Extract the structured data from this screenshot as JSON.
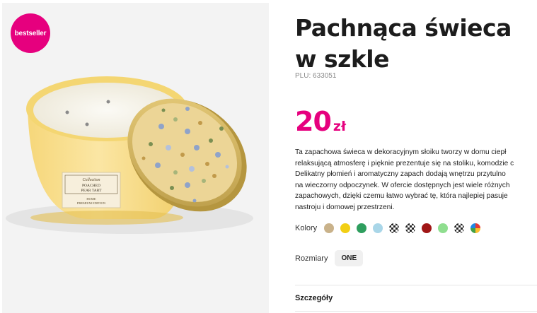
{
  "gallery": {
    "badge": "bestseller",
    "jar_label": {
      "script": "Collection",
      "name_line1": "POACHED",
      "name_line2": "PEAR TART",
      "line3": "HOME",
      "line4": "PREMIUM EDITION"
    }
  },
  "product": {
    "title": "Pachnąca świeca w szkle",
    "plu": "PLU: 633051",
    "price": "20",
    "currency": "zł",
    "description": [
      "Ta zapachowa świeca w dekoracyjnym słoiku tworzy w domu ciepł",
      "relaksującą atmosferę i pięknie prezentuje się na stoliku, komodzie c",
      "Delikatny płomień i aromatyczny zapach dodają wnętrzu przytulno",
      "na wieczorny odpoczynek. W ofercie dostępnych jest wiele różnych",
      "zapachowych, dzięki czemu łatwo wybrać tę, która najlepiej pasuje",
      "nastroju i domowej przestrzeni."
    ]
  },
  "options": {
    "colors_label": "Kolory",
    "colors": [
      {
        "color": "#c9b28a",
        "pattern": "solid"
      },
      {
        "color": "#f2cf14",
        "pattern": "solid"
      },
      {
        "color": "#2e9e5e",
        "pattern": "solid"
      },
      {
        "color": "#a9d6e8",
        "pattern": "solid"
      },
      {
        "color": "#222222",
        "pattern": "checker"
      },
      {
        "color": "#222222",
        "pattern": "checker"
      },
      {
        "color": "#a01616",
        "pattern": "solid"
      },
      {
        "color": "#8fde8f",
        "pattern": "solid"
      },
      {
        "color": "#222222",
        "pattern": "checker"
      },
      {
        "color": "multicolor",
        "pattern": "multi"
      }
    ],
    "sizes_label": "Rozmiary",
    "size": "ONE"
  },
  "details": {
    "title": "Szczegóły"
  },
  "theme": {
    "accent": "#e6007e"
  }
}
